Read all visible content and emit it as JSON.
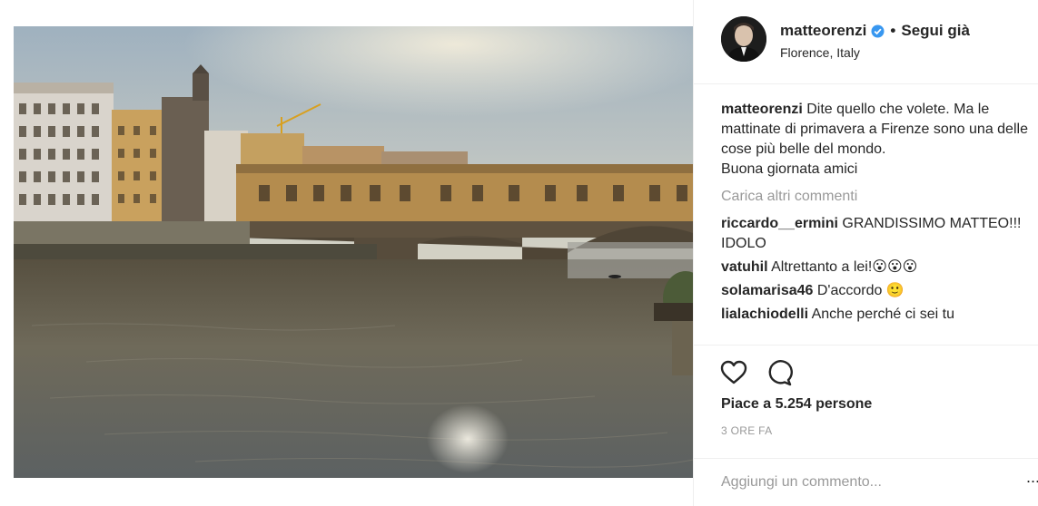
{
  "post": {
    "username": "matteorenzi",
    "follow_label": "Segui già",
    "separator": "•",
    "location": "Florence, Italy",
    "caption": "Dite quello che volete. Ma le mattinate di primavera a Firenze sono una delle cose più belle del mondo.",
    "caption_line2": "Buona giornata amici",
    "load_more": "Carica altri commenti",
    "comments": [
      {
        "user": "riccardo__ermini",
        "text": "GRANDISSIMO MATTEO!!! IDOLO"
      },
      {
        "user": "vatuhil",
        "text": "Altrettanto a lei!😮😮😮"
      },
      {
        "user": "solamarisa46",
        "text": "D'accordo 🙂"
      },
      {
        "user": "lialachiodelli",
        "text": "Anche perché ci sei tu"
      }
    ],
    "likes": "Piace a 5.254 persone",
    "time": "3 ORE FA",
    "add_comment_placeholder": "Aggiungi un commento...",
    "more_options": "..."
  },
  "icons": {
    "like": "heart-icon",
    "comment": "speech-bubble-icon",
    "verified": "verified-badge-icon"
  },
  "colors": {
    "text": "#262626",
    "muted": "#999999",
    "verified": "#3897f0",
    "border": "#efefef"
  }
}
